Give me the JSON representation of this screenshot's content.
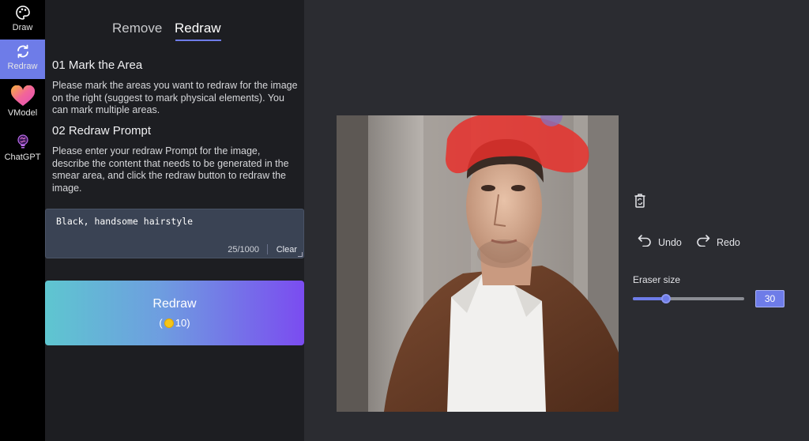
{
  "nav": {
    "items": [
      {
        "label": "Draw",
        "icon": "palette-icon"
      },
      {
        "label": "Redraw",
        "icon": "refresh-icon",
        "active": true
      },
      {
        "label": "VModel",
        "icon": "heart-icon"
      },
      {
        "label": "ChatGPT",
        "icon": "brain-bulb-icon"
      }
    ]
  },
  "tabs": {
    "remove": "Remove",
    "redraw": "Redraw"
  },
  "steps": {
    "mark_title": "01 Mark the Area",
    "mark_desc": "Please mark the areas you want to redraw for the image on the right (suggest to mark physical elements). You can mark multiple areas.",
    "prompt_title": "02 Redraw Prompt",
    "prompt_desc": "Please enter your redraw Prompt for the image, describe the content that needs to be generated in the smear area, and click the redraw button to redraw the image."
  },
  "prompt": {
    "value": "Black, handsome hairstyle",
    "count": "25/1000",
    "clear_label": "Clear"
  },
  "redraw_button": {
    "label": "Redraw",
    "cost_open": "(",
    "cost_value": "10",
    "cost_close": ")"
  },
  "tools": {
    "undo_label": "Undo",
    "redo_label": "Redo",
    "eraser_label": "Eraser size",
    "eraser_value": "30",
    "eraser_fraction": 0.3
  },
  "colors": {
    "accent": "#6e7ce8",
    "mask": "#e8302b"
  }
}
